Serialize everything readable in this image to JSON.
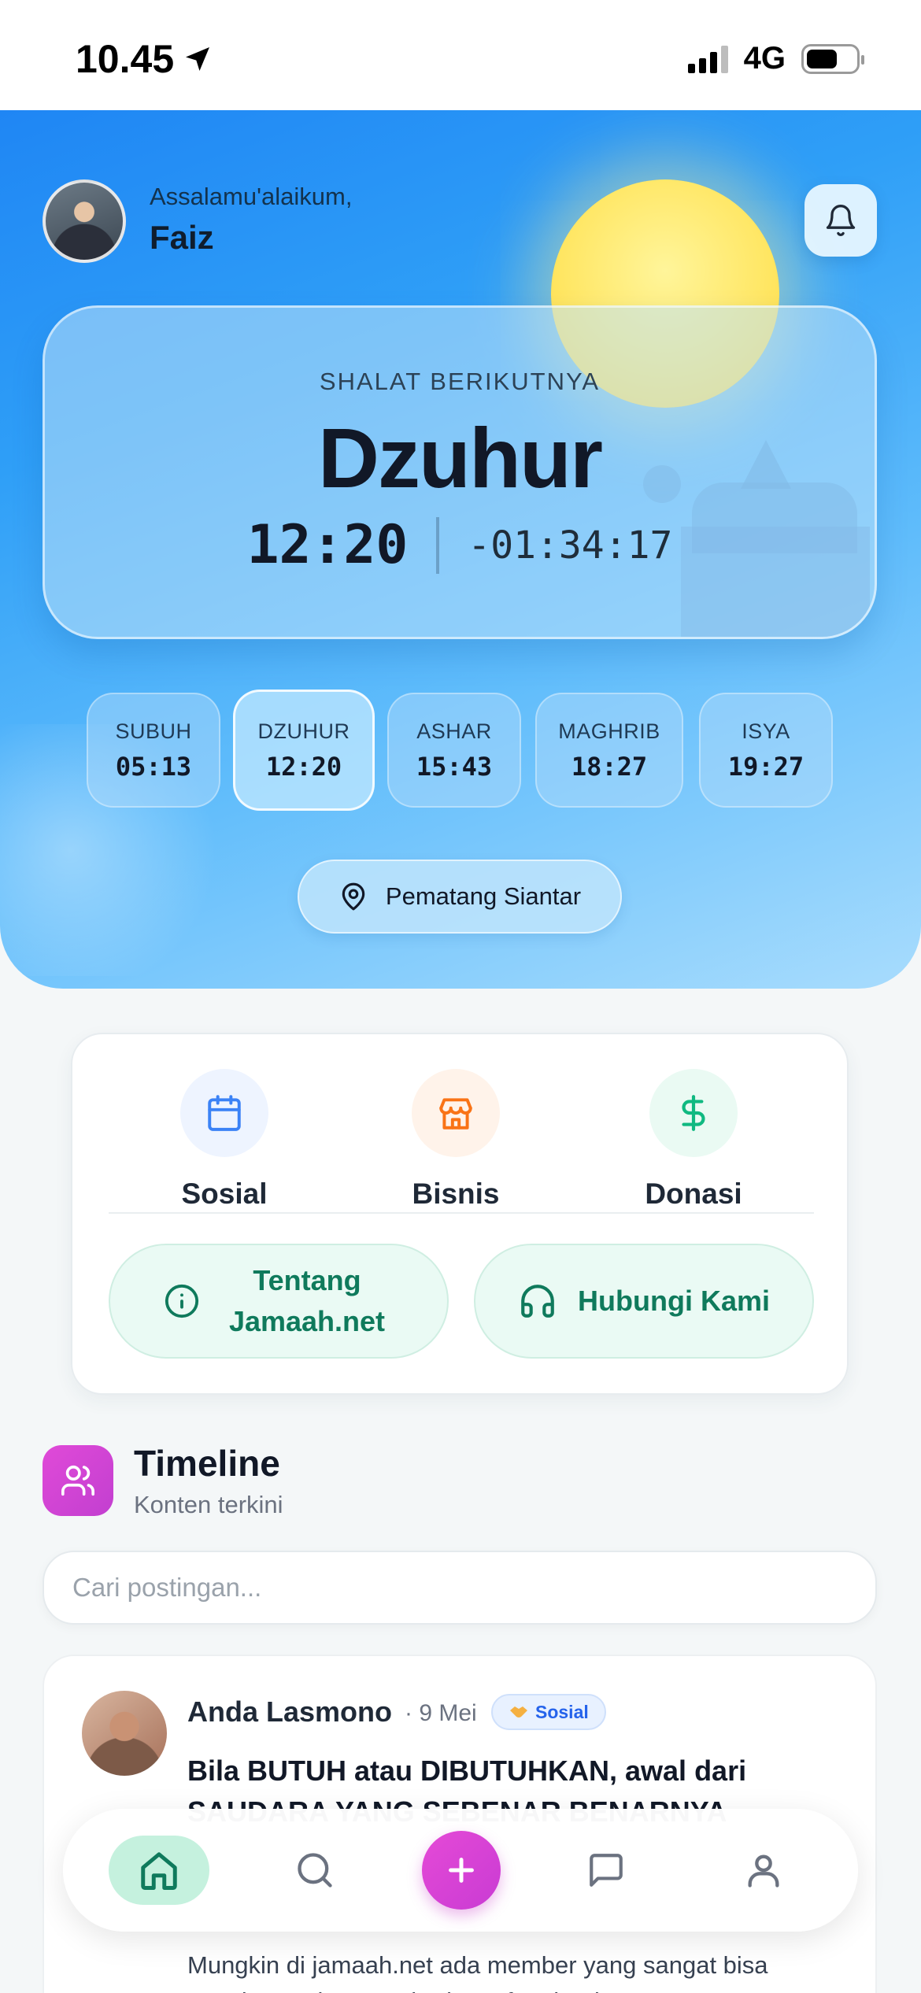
{
  "status": {
    "time": "10.45",
    "network": "4G"
  },
  "header": {
    "greeting": "Assalamu'alaikum,",
    "user_name": "Faiz"
  },
  "next_prayer": {
    "label": "SHALAT BERIKUTNYA",
    "name": "Dzuhur",
    "time": "12:20",
    "countdown": "-01:34:17"
  },
  "prayers": [
    {
      "name": "SUBUH",
      "time": "05:13"
    },
    {
      "name": "DZUHUR",
      "time": "12:20"
    },
    {
      "name": "ASHAR",
      "time": "15:43"
    },
    {
      "name": "MAGHRIB",
      "time": "18:27"
    },
    {
      "name": "ISYA",
      "time": "19:27"
    }
  ],
  "active_prayer": "DZUHUR",
  "location": "Pematang Siantar",
  "menu": {
    "items": [
      {
        "label": "Sosial",
        "icon": "calendar-icon"
      },
      {
        "label": "Bisnis",
        "icon": "store-icon"
      },
      {
        "label": "Donasi",
        "icon": "dollar-icon"
      }
    ],
    "about_label": "Tentang Jamaah.net",
    "contact_label": "Hubungi Kami"
  },
  "timeline": {
    "title": "Timeline",
    "subtitle": "Konten terkini",
    "search_placeholder": "Cari postingan..."
  },
  "post": {
    "author": "Anda Lasmono",
    "date": "· 9 Mei",
    "tag": "Sosial",
    "title": "Bila BUTUH atau DIBUTUHKAN, awal dari SAUDARA YANG SEBENAR BENARNYA",
    "body": "Mungkin di jamaah.net ada member yang sangat bisa membantu dan memberi manfaat bagi"
  },
  "bottom_nav": {
    "items": [
      "home-icon",
      "search-icon",
      "add-icon",
      "chat-icon",
      "profile-icon"
    ],
    "active": "home-icon"
  },
  "colors": {
    "primary_green": "#0f7a5c",
    "accent_magenta": "#d845d4",
    "sky_blue": "#2f9ff7"
  }
}
